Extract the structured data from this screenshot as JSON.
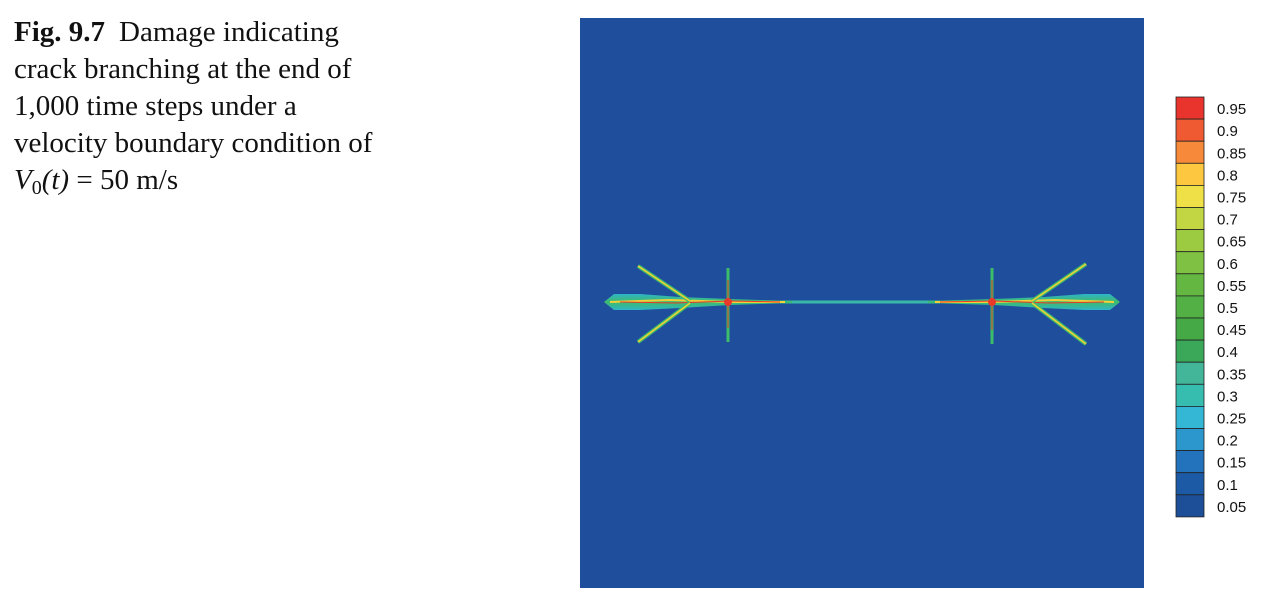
{
  "caption": {
    "label": "Fig. 9.7",
    "text": "Damage indicating crack branching at the end of 1,000 time steps under a velocity boundary condition of",
    "formula_symbol": "V",
    "formula_subscript": "0",
    "formula_arg": "(t)",
    "formula_value": " = 50 m/s"
  },
  "colors": {
    "background": "#1f4f9c",
    "crack_core": "#e8392a",
    "crack_mid": "#f2d03a",
    "crack_outer": "#3dbc6a",
    "crack_edge": "#2fb3c8"
  },
  "chart_data": {
    "type": "heatmap",
    "colorbar": {
      "levels": [
        "0.95",
        "0.9",
        "0.85",
        "0.8",
        "0.75",
        "0.7",
        "0.65",
        "0.6",
        "0.55",
        "0.5",
        "0.45",
        "0.4",
        "0.35",
        "0.3",
        "0.25",
        "0.2",
        "0.15",
        "0.1",
        "0.05"
      ],
      "colors": [
        "#e8342c",
        "#f05a32",
        "#f78a3a",
        "#fdc840",
        "#f0e048",
        "#c2d542",
        "#9ccb42",
        "#7fc143",
        "#64b842",
        "#52b044",
        "#45aa46",
        "#3ba758",
        "#43b69a",
        "#36bdb0",
        "#34b7d4",
        "#2c97cc",
        "#2273bb",
        "#1d5aa6",
        "#1d4e98"
      ]
    }
  }
}
